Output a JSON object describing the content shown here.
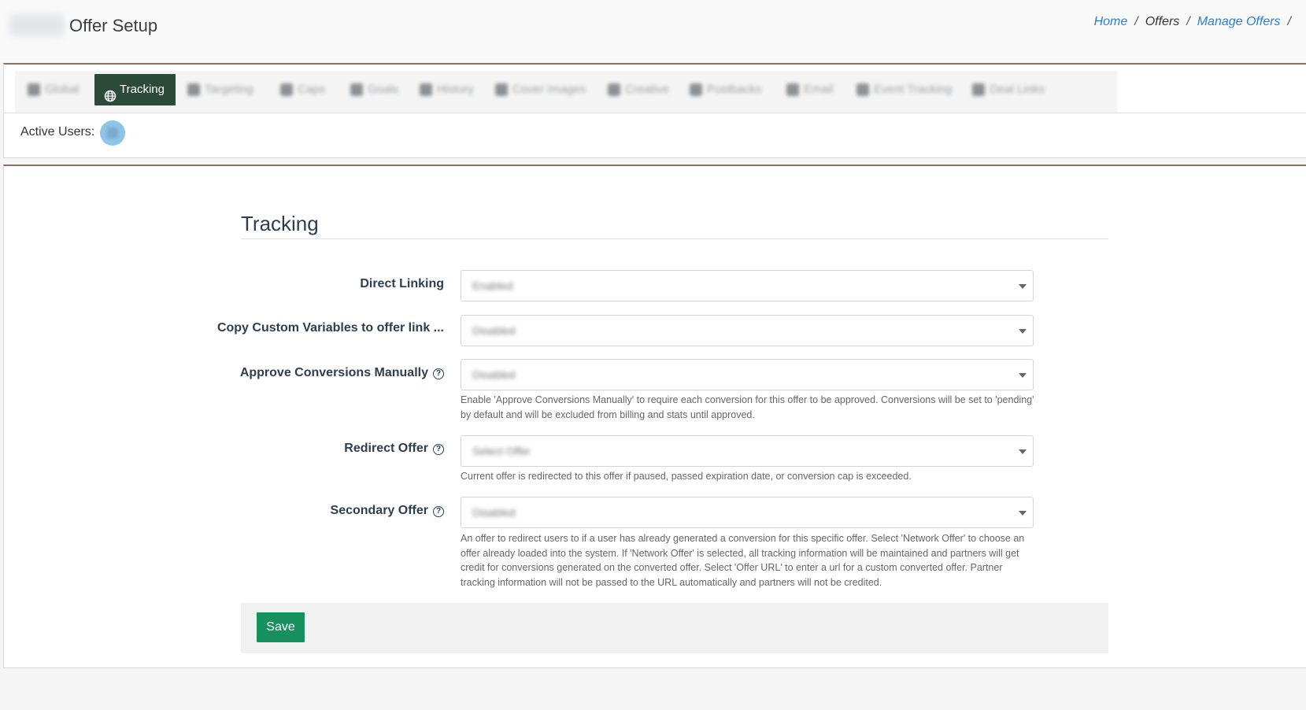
{
  "header": {
    "title": "Offer Setup",
    "breadcrumb": [
      {
        "label": "Home"
      },
      {
        "label": "Offers"
      },
      {
        "label": "Manage Offers"
      }
    ],
    "separator": "/"
  },
  "tabs": [
    {
      "label": "Global",
      "icon": "back-icon",
      "active": false
    },
    {
      "label": "Tracking",
      "icon": "globe-icon",
      "active": true
    },
    {
      "label": "Targeting",
      "icon": "target-icon",
      "active": false
    },
    {
      "label": "Caps",
      "icon": "tag-icon",
      "active": false
    },
    {
      "label": "Goals",
      "icon": "goal-icon",
      "active": false
    },
    {
      "label": "History",
      "icon": "history-icon",
      "active": false
    },
    {
      "label": "Cover Images",
      "icon": "image-icon",
      "active": false
    },
    {
      "label": "Creative",
      "icon": "file-icon",
      "active": false
    },
    {
      "label": "Postbacks",
      "icon": "sitemap-icon",
      "active": false
    },
    {
      "label": "Email",
      "icon": "email-icon",
      "active": false
    },
    {
      "label": "Event Tracking",
      "icon": "event-icon",
      "active": false
    },
    {
      "label": "Deal Links",
      "icon": "link-icon",
      "active": false
    }
  ],
  "active_users": {
    "label": "Active Users:"
  },
  "form": {
    "section_title": "Tracking",
    "fields": [
      {
        "label": "Direct Linking",
        "value": "Enabled",
        "has_help": false
      },
      {
        "label": "Copy Custom Variables to offer link ...",
        "value": "Disabled",
        "has_help": false
      },
      {
        "label": "Approve Conversions Manually",
        "value": "Disabled",
        "has_help": true,
        "help": "Enable 'Approve Conversions Manually' to require each conversion for this offer to be approved. Conversions will be set to 'pending' by default and will be excluded from billing and stats until approved."
      },
      {
        "label": "Redirect Offer",
        "value": "Select Offer",
        "has_help": true,
        "help": "Current offer is redirected to this offer if paused, passed expiration date, or conversion cap is exceeded."
      },
      {
        "label": "Secondary Offer",
        "value": "Disabled",
        "has_help": true,
        "help": "An offer to redirect users to if a user has already generated a conversion for this specific offer. Select 'Network Offer' to choose an offer already loaded into the system. If 'Network Offer' is selected, all tracking information will be maintained and partners will get credit for conversions generated on the converted offer. Select 'Offer URL' to enter a url for a custom converted offer. Partner tracking information will not be passed to the URL automatically and partners will not be credited."
      }
    ],
    "help_icon_glyph": "?",
    "save_label": "Save"
  },
  "colors": {
    "active_tab": "#2b4a3a",
    "link": "#2a7fd4",
    "save": "#16915e",
    "panel_border": "#8a6f63"
  }
}
